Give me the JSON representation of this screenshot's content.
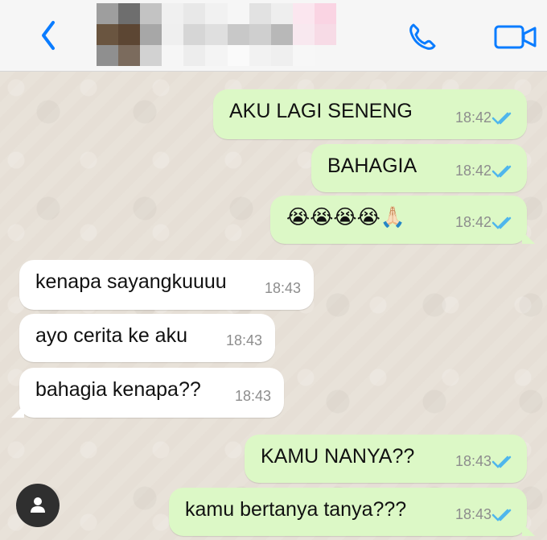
{
  "header": {
    "contact_name": "",
    "back_icon": "chevron-left-icon",
    "call_icon": "phone-icon",
    "video_icon": "video-camera-icon"
  },
  "messages": [
    {
      "sender": "me",
      "text": "AKU LAGI SENENG",
      "time": "18:42",
      "status": "read"
    },
    {
      "sender": "me",
      "text": "BAHAGIA",
      "time": "18:42",
      "status": "read"
    },
    {
      "sender": "me",
      "text": "😭😭😭😭🙏🏻",
      "time": "18:42",
      "status": "read"
    },
    {
      "sender": "other",
      "text": "kenapa sayangkuuuu",
      "time": "18:43"
    },
    {
      "sender": "other",
      "text": "ayo cerita ke aku",
      "time": "18:43"
    },
    {
      "sender": "other",
      "text": "bahagia kenapa??",
      "time": "18:43"
    },
    {
      "sender": "me",
      "text": "KAMU NANYA??",
      "time": "18:43",
      "status": "read"
    },
    {
      "sender": "me",
      "text": "kamu bertanya tanya???",
      "time": "18:43",
      "status": "read"
    }
  ],
  "colors": {
    "accent": "#0a7cff",
    "outgoing_bubble": "#dcf8c6",
    "incoming_bubble": "#ffffff",
    "read_ticks": "#4fb6ec",
    "chat_bg": "#e6dfd6"
  }
}
